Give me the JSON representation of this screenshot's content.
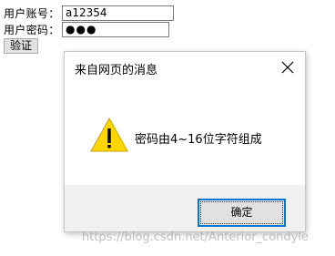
{
  "form": {
    "account_label": "用户账号：",
    "account_value": "a12354",
    "password_label": "用户密码：",
    "password_value": "●●●",
    "verify_button": "验证"
  },
  "dialog": {
    "title": "来自网页的消息",
    "message": "密码由4~16位字符组成",
    "ok_button": "确定",
    "icons": {
      "close": "close-icon",
      "warning": "warning-icon"
    }
  },
  "watermark": "https://blog.csdn.net/Anterior_condyle",
  "colors": {
    "warning_fill": "#ffd700",
    "focus_border": "#0078d7",
    "footer_bg": "#f0f0f0"
  }
}
